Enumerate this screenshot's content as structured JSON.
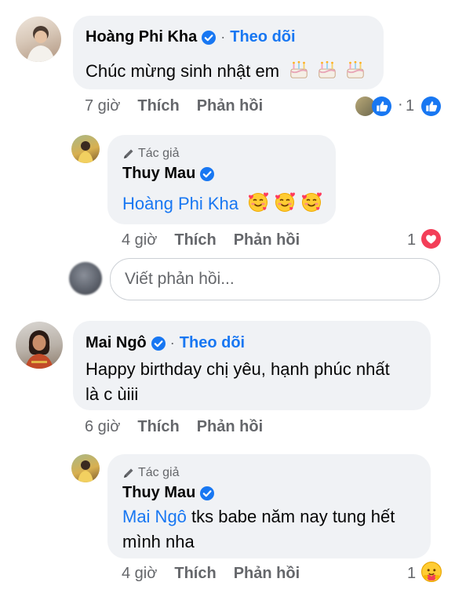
{
  "comments": [
    {
      "author": "Hoàng Phi Kha",
      "follow_label": "Theo dõi",
      "text": "Chúc mừng sinh nhật em",
      "time": "7 giờ",
      "like_label": "Thích",
      "reply_label": "Phản hồi",
      "reaction_count": "1",
      "reply_count": "1",
      "reply": {
        "author_tag": "Tác giả",
        "author": "Thuy Mau",
        "mention": "Hoàng Phi Kha",
        "text": "",
        "time": "4 giờ",
        "like_label": "Thích",
        "reply_label": "Phản hồi",
        "reaction_count": "1"
      }
    },
    {
      "author": "Mai Ngô",
      "follow_label": "Theo dõi",
      "text_line1": "Happy birthday chị yêu, hạnh phúc nhất",
      "text_line2": "là c ùiii",
      "time": "6 giờ",
      "like_label": "Thích",
      "reply_label": "Phản hồi",
      "reply": {
        "author_tag": "Tác giả",
        "author": "Thuy Mau",
        "mention": "Mai Ngô",
        "text_line1": "tks babe năm nay tung hết",
        "text_line2": "mình nha",
        "time": "4 giờ",
        "like_label": "Thích",
        "reply_label": "Phản hồi",
        "reaction_count": "1"
      }
    }
  ],
  "reply_input": {
    "placeholder": "Viết phản hồi..."
  },
  "colors": {
    "link": "#1877f2",
    "bubble": "#f0f2f5",
    "meta": "#65676b",
    "love": "#f33e58"
  },
  "icons": [
    "verified-badge-icon",
    "cake-emoji-icon",
    "smiling-hearts-emoji-icon",
    "like-reaction-icon",
    "love-reaction-icon",
    "care-reaction-icon",
    "pencil-icon"
  ]
}
